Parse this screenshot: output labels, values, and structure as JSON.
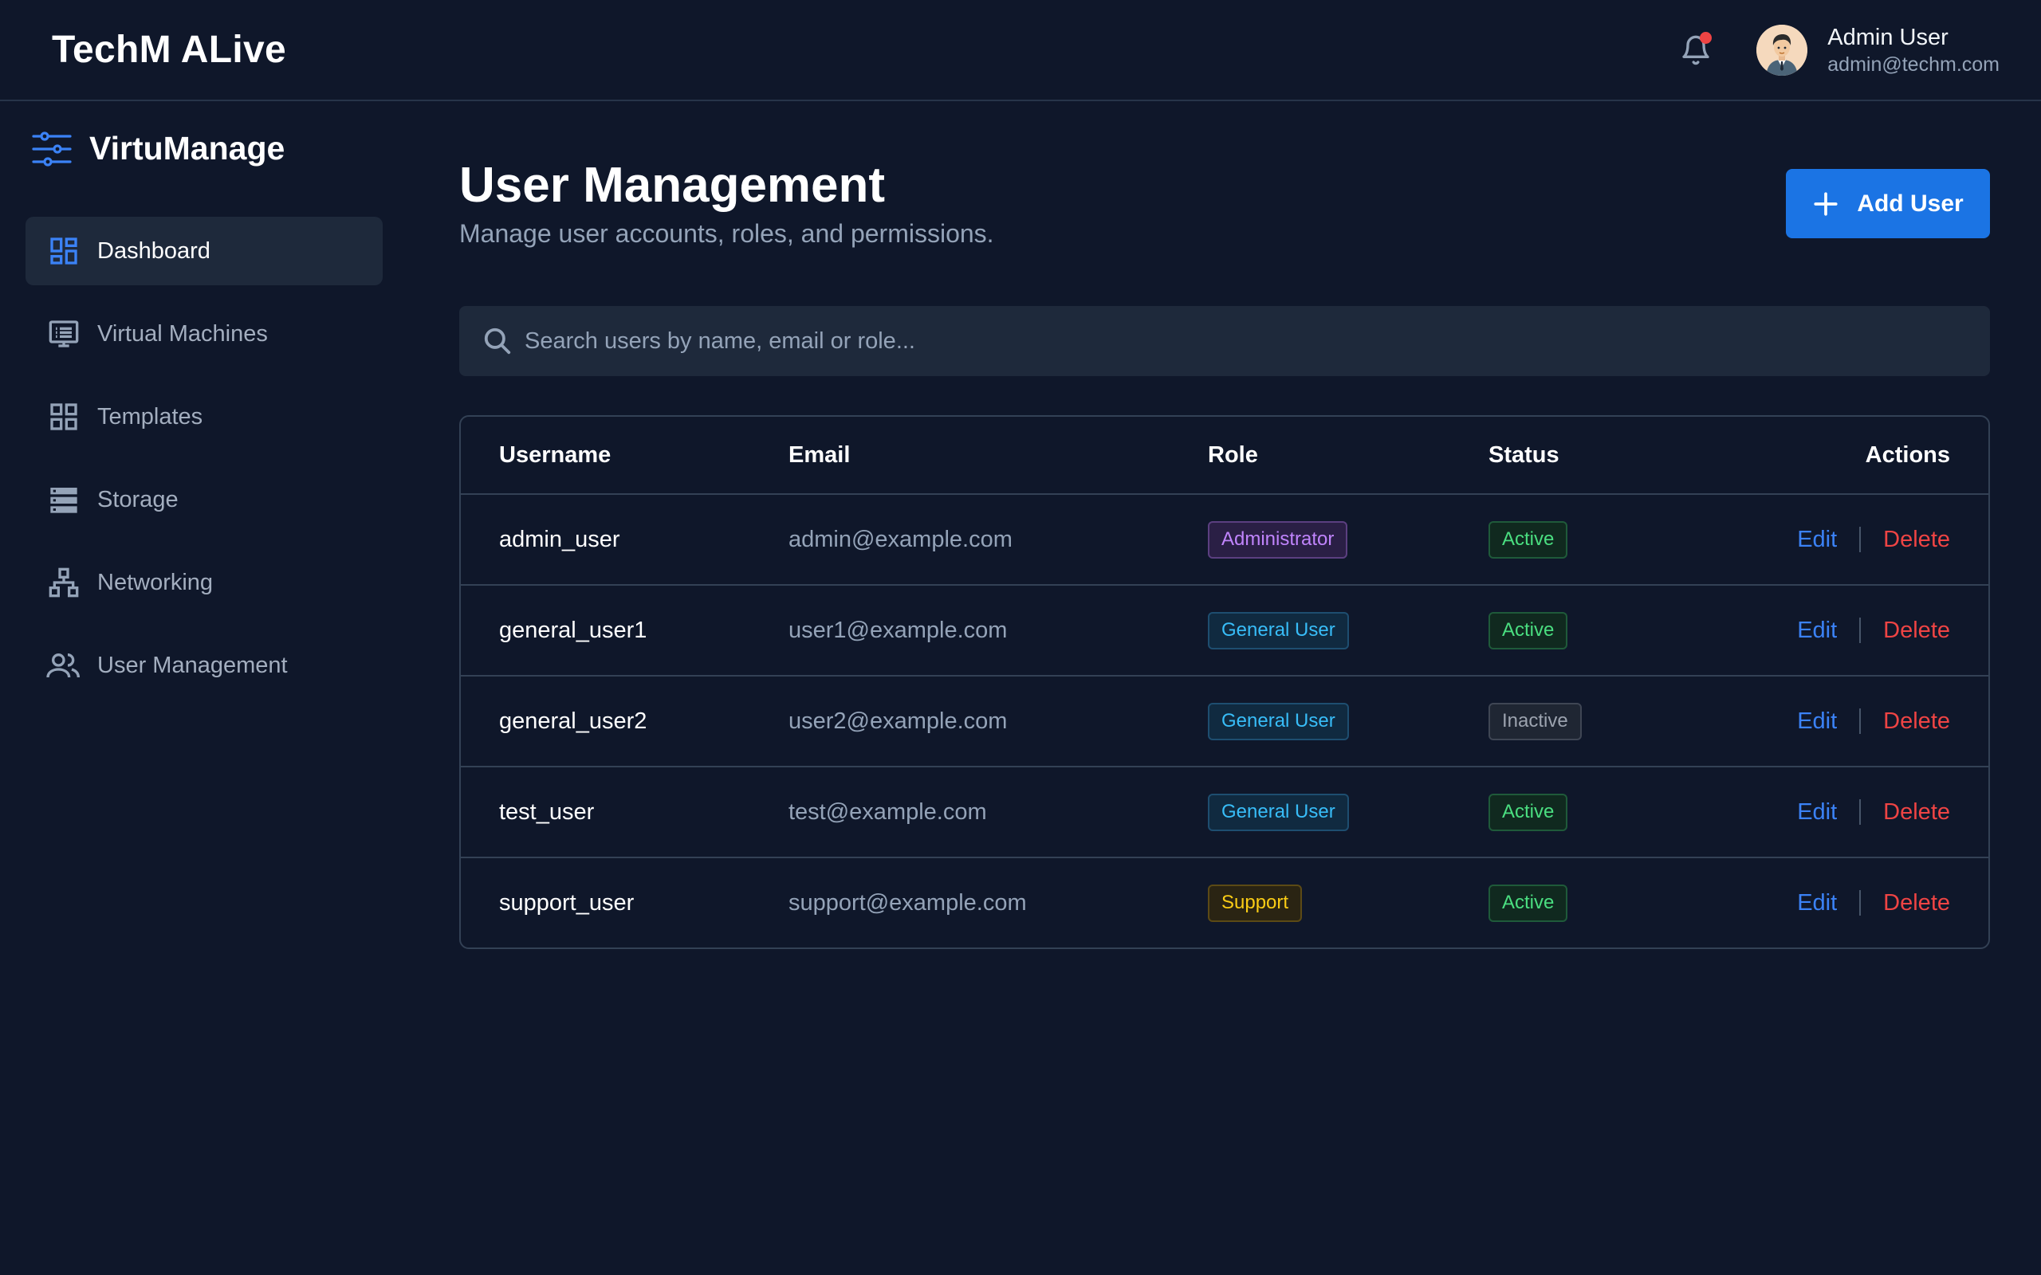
{
  "header": {
    "brand": "TechM ALive",
    "user": {
      "name": "Admin User",
      "email": "admin@techm.com"
    },
    "icons": {
      "notifications": "bell-icon",
      "avatar": "user-avatar"
    }
  },
  "sidebar": {
    "brand": "VirtuManage",
    "brand_icon": "sliders-icon",
    "items": [
      {
        "label": "Dashboard",
        "icon": "dashboard-icon",
        "active": true
      },
      {
        "label": "Virtual Machines",
        "icon": "monitor-icon",
        "active": false
      },
      {
        "label": "Templates",
        "icon": "grid-icon",
        "active": false
      },
      {
        "label": "Storage",
        "icon": "storage-icon",
        "active": false
      },
      {
        "label": "Networking",
        "icon": "network-icon",
        "active": false
      },
      {
        "label": "User Management",
        "icon": "users-icon",
        "active": false
      }
    ]
  },
  "main": {
    "title": "User Management",
    "subtitle": "Manage user accounts, roles, and permissions.",
    "add_button": "Add User",
    "search": {
      "placeholder": "Search users by name, email or role...",
      "value": ""
    },
    "table": {
      "columns": {
        "username": "Username",
        "email": "Email",
        "role": "Role",
        "status": "Status",
        "actions": "Actions"
      },
      "edit_label": "Edit",
      "delete_label": "Delete",
      "rows": [
        {
          "username": "admin_user",
          "email": "admin@example.com",
          "role": "Administrator",
          "status": "Active"
        },
        {
          "username": "general_user1",
          "email": "user1@example.com",
          "role": "General User",
          "status": "Active"
        },
        {
          "username": "general_user2",
          "email": "user2@example.com",
          "role": "General User",
          "status": "Inactive"
        },
        {
          "username": "test_user",
          "email": "test@example.com",
          "role": "General User",
          "status": "Active"
        },
        {
          "username": "support_user",
          "email": "support@example.com",
          "role": "Support",
          "status": "Active"
        }
      ]
    }
  },
  "colors": {
    "background": "#0f172a",
    "accent": "#1b74e4",
    "edit": "#3b82f6",
    "delete": "#ef4444",
    "role_administrator": "#c084fc",
    "role_general_user": "#38bdf8",
    "role_support": "#facc15",
    "status_active": "#4ade80",
    "status_inactive": "#9ca3af"
  }
}
